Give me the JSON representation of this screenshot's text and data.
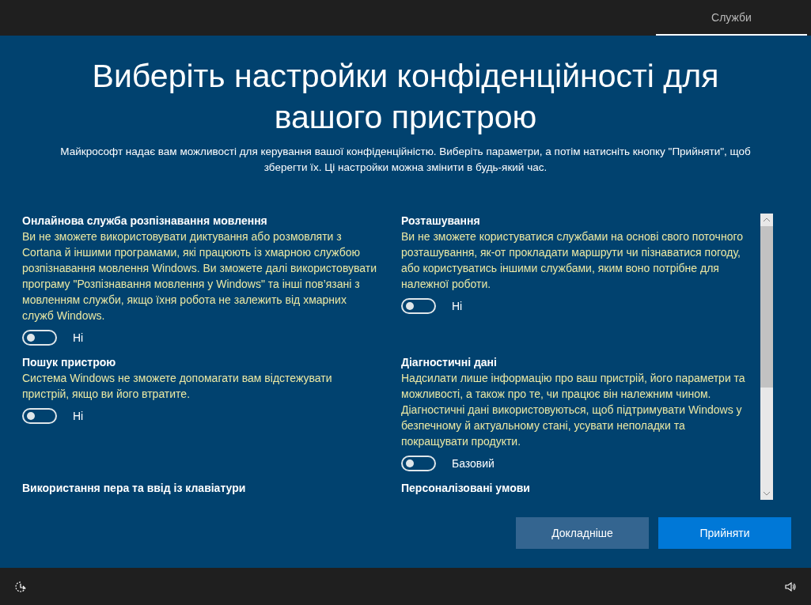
{
  "top_bar": {
    "tabs": [
      {
        "label": "Служби",
        "selected": true
      }
    ]
  },
  "title": "Виберіть настройки конфіденційності для вашого пристрою",
  "intro": "Майкрософт надає вам можливості для керування вашої конфіденційністю. Виберіть параметри, а потім натисніть кнопку \"Прийняти\", щоб зберегти їх. Ці настройки можна змінити в будь-який час.",
  "settings": [
    {
      "heading": "Онлайнова служба розпізнавання мовлення",
      "description": "Ви не зможете використовувати диктування або розмовляти з Cortana й іншими програмами, які працюють із хмарною службою розпізнавання мовлення Windows. Ви зможете далі використовувати програму \"Розпізнавання мовлення у Windows\" та інші пов’язані з мовленням служби, якщо їхня робота не залежить від хмарних служб Windows.",
      "toggle": {
        "on": false,
        "label": "Ні"
      }
    },
    {
      "heading": "Розташування",
      "description": "Ви не зможете користуватися службами на основі свого поточного розташування, як-от прокладати маршрути чи пізнаватися погоду, або користуватись іншими службами, яким воно потрібне для належної роботи.",
      "toggle": {
        "on": false,
        "label": "Ні"
      }
    },
    {
      "heading": "Пошук пристрою",
      "description": "Система Windows не зможете допомагати вам відстежувати пристрій, якщо ви його втратите.",
      "toggle": {
        "on": false,
        "label": "Ні"
      }
    },
    {
      "heading": "Діагностичні дані",
      "description": "Надсилати лише інформацію про ваш пристрій, його параметри та можливості, а також про те, чи працює він належним чином. Діагностичні дані використовуються, щоб підтримувати Windows у безпечному й актуальному стані, усувати неполадки та покращувати продукти.",
      "toggle": {
        "on": false,
        "label": "Базовий"
      }
    },
    {
      "heading": "Використання пера та ввід із клавіатури"
    },
    {
      "heading": "Персоналізовані умови"
    }
  ],
  "buttons": [
    {
      "label": "Докладніше",
      "kind": "secondary"
    },
    {
      "label": "Прийняти",
      "kind": "primary"
    }
  ]
}
